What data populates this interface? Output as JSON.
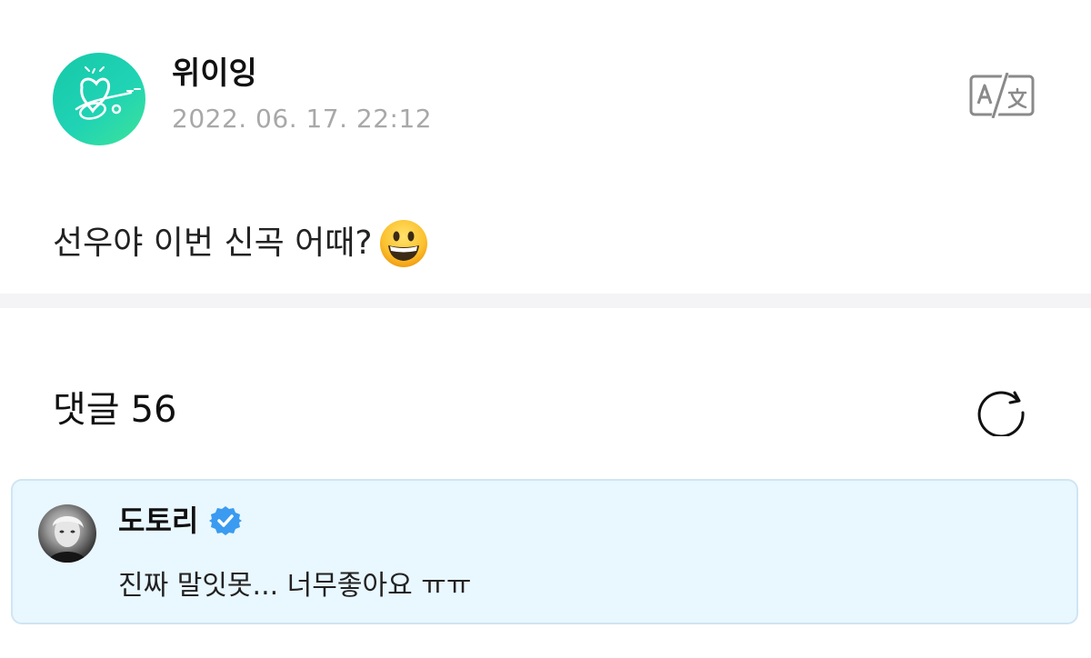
{
  "post": {
    "author": "위이잉",
    "date": "2022. 06. 17. 22:12",
    "text": "선우야 이번 신곡 어때?",
    "emoji_icon": "grinning-face-emoji"
  },
  "comments": {
    "label": "댓글",
    "count": "56"
  },
  "comment_list": [
    {
      "author": "도토리",
      "verified": true,
      "text": "진짜 말잇못... 너무좋아요 ㅠㅠ"
    }
  ],
  "colors": {
    "avatar_gradient_start": "#16c8a8",
    "avatar_gradient_end": "#3ee39a",
    "comment_bg": "#e9f7ff",
    "comment_border": "#cfe5f3",
    "verified_blue": "#3a9bf0",
    "date_gray": "#a8a8a8"
  }
}
